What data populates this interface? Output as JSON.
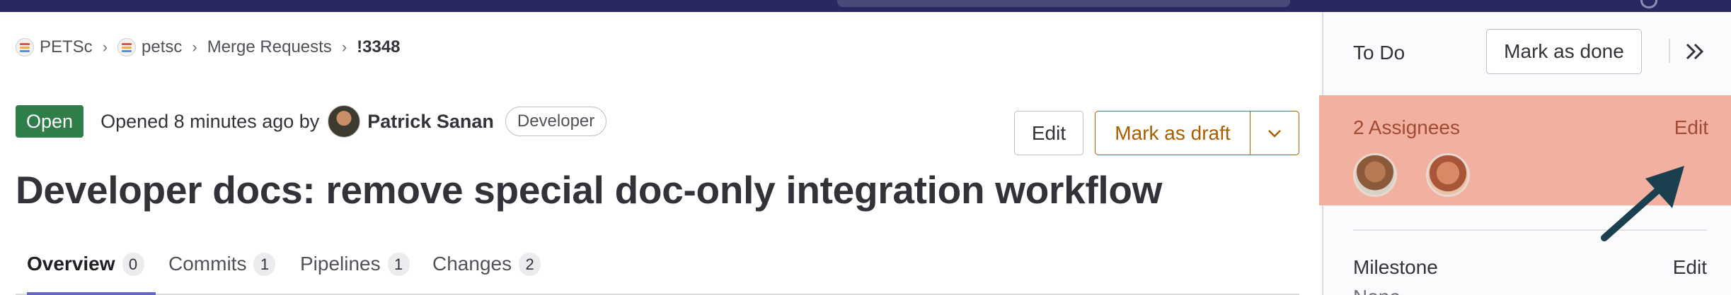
{
  "breadcrumb": {
    "items": [
      "PETSc",
      "petsc",
      "Merge Requests",
      "!3348"
    ]
  },
  "merge_request": {
    "status": "Open",
    "opened_text": "Opened 8 minutes ago by",
    "author": "Patrick Sanan",
    "author_role": "Developer",
    "title": "Developer docs: remove special doc-only integration workflow"
  },
  "actions": {
    "edit_label": "Edit",
    "draft_label": "Mark as draft"
  },
  "tabs": [
    {
      "label": "Overview",
      "count": "0"
    },
    {
      "label": "Commits",
      "count": "1"
    },
    {
      "label": "Pipelines",
      "count": "1"
    },
    {
      "label": "Changes",
      "count": "2"
    }
  ],
  "sidebar": {
    "todo_label": "To Do",
    "mark_done_label": "Mark as done",
    "assignees_label": "2 Assignees",
    "assignees_edit": "Edit",
    "milestone_label": "Milestone",
    "milestone_edit": "Edit",
    "milestone_value": "None"
  },
  "colors": {
    "status_open": "#2f7d48",
    "draft_accent": "#a85d00",
    "assignee_highlight": "#f2b0a0",
    "arrow": "#1a4050",
    "tab_active_underline": "#6666c4"
  }
}
